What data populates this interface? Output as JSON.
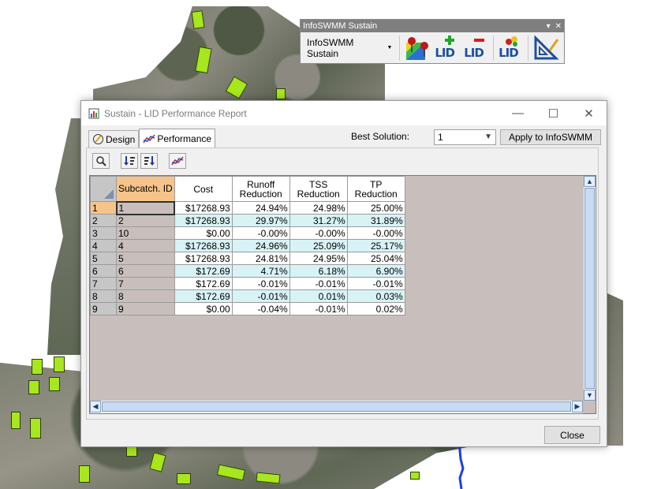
{
  "toolbar": {
    "title": "InfoSWMM Sustain",
    "menu_label": "InfoSWMM Sustain",
    "lid_label": "LID",
    "icons": [
      "map-pin-icon",
      "lid-add-icon",
      "lid-remove-icon",
      "lid-edit-icon",
      "triangle-ruler-icon"
    ]
  },
  "dialog": {
    "title": "Sustain - LID Performance Report",
    "tabs": [
      {
        "label": "Design",
        "icon": "pencil-circle-icon"
      },
      {
        "label": "Performance",
        "icon": "line-chart-icon"
      }
    ],
    "best_solution_label": "Best Solution:",
    "best_solution_value": "1",
    "apply_label": "Apply to InfoSWMM",
    "close_label": "Close",
    "grid": {
      "columns": [
        "Subcatch. ID",
        "Cost",
        "Runoff Reduction",
        "TSS Reduction",
        "TP Reduction"
      ],
      "column_lines": [
        [
          "Subcatch. ID"
        ],
        [
          "Cost"
        ],
        [
          "Runoff",
          "Reduction"
        ],
        [
          "TSS",
          "Reduction"
        ],
        [
          "TP",
          "Reduction"
        ]
      ],
      "rows": [
        {
          "n": "1",
          "id": "1",
          "cost": "$17268.93",
          "runoff": "24.94%",
          "tss": "24.98%",
          "tp": "25.00%",
          "hl": false,
          "sel": true
        },
        {
          "n": "2",
          "id": "2",
          "cost": "$17268.93",
          "runoff": "29.97%",
          "tss": "31.27%",
          "tp": "31.89%",
          "hl": true,
          "sel": false
        },
        {
          "n": "3",
          "id": "10",
          "cost": "$0.00",
          "runoff": "-0.00%",
          "tss": "-0.00%",
          "tp": "-0.00%",
          "hl": false,
          "sel": false
        },
        {
          "n": "4",
          "id": "4",
          "cost": "$17268.93",
          "runoff": "24.96%",
          "tss": "25.09%",
          "tp": "25.17%",
          "hl": true,
          "sel": false
        },
        {
          "n": "5",
          "id": "5",
          "cost": "$17268.93",
          "runoff": "24.81%",
          "tss": "24.95%",
          "tp": "25.04%",
          "hl": false,
          "sel": false
        },
        {
          "n": "6",
          "id": "6",
          "cost": "$172.69",
          "runoff": "4.71%",
          "tss": "6.18%",
          "tp": "6.90%",
          "hl": true,
          "sel": false
        },
        {
          "n": "7",
          "id": "7",
          "cost": "$172.69",
          "runoff": "-0.01%",
          "tss": "-0.01%",
          "tp": "-0.01%",
          "hl": false,
          "sel": false
        },
        {
          "n": "8",
          "id": "8",
          "cost": "$172.69",
          "runoff": "-0.01%",
          "tss": "0.01%",
          "tp": "0.03%",
          "hl": true,
          "sel": false
        },
        {
          "n": "9",
          "id": "9",
          "cost": "$0.00",
          "runoff": "-0.04%",
          "tss": "-0.01%",
          "tp": "0.02%",
          "hl": false,
          "sel": false
        }
      ]
    }
  },
  "colors": {
    "selected_header": "#f6c48a",
    "highlight_row": "#d8f3f5",
    "grid_empty": "#c8bfbd",
    "roof_green": "#a8e61d"
  }
}
